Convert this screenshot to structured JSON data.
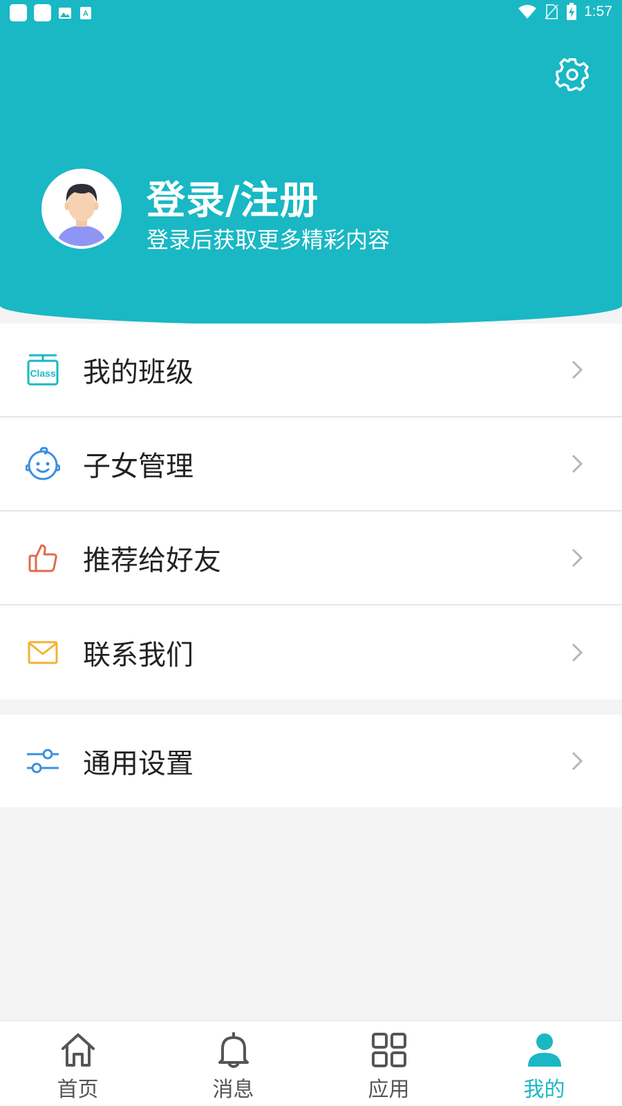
{
  "status_bar": {
    "time": "1:57"
  },
  "colors": {
    "accent": "#19b8c4",
    "class_icon": "#19b8c4",
    "child_icon": "#3a8fe0",
    "like_icon": "#e06a4d",
    "mail_icon": "#f3b234",
    "settings_icon": "#3a8fe0"
  },
  "profile": {
    "title": "登录/注册",
    "subtitle": "登录后获取更多精彩内容"
  },
  "menu": {
    "items": [
      {
        "label": "我的班级",
        "icon": "class-icon"
      },
      {
        "label": "子女管理",
        "icon": "baby-face-icon"
      },
      {
        "label": "推荐给好友",
        "icon": "thumbs-up-icon"
      },
      {
        "label": "联系我们",
        "icon": "mail-icon"
      }
    ],
    "settings": {
      "label": "通用设置",
      "icon": "sliders-icon"
    }
  },
  "nav": {
    "items": [
      {
        "label": "首页",
        "icon": "home-icon"
      },
      {
        "label": "消息",
        "icon": "bell-icon"
      },
      {
        "label": "应用",
        "icon": "grid-icon"
      },
      {
        "label": "我的",
        "icon": "person-icon",
        "active": true
      }
    ]
  }
}
